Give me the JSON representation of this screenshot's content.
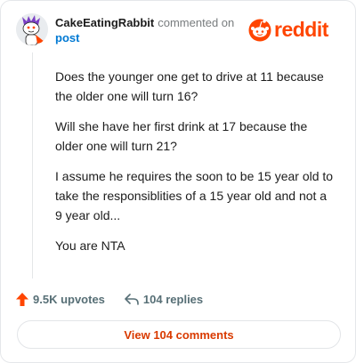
{
  "comment": {
    "author": "CakeEatingRabbit",
    "meta_text": "commented on",
    "post_link": "post",
    "paragraphs": [
      "Does the younger one get to drive at 11 because the older one will turn 16?",
      "Will she have her first drink at 17 because the older one will turn 21?",
      "I assume he requires the soon to be 15 year old to take the responsiblities of a 15 year old and not a 9 year old...",
      "You are NTA"
    ]
  },
  "brand": {
    "name": "reddit",
    "color": "#ff4500"
  },
  "actions": {
    "upvotes": "9.5K upvotes",
    "replies": "104 replies"
  },
  "view_button": {
    "label": "View 104 comments"
  },
  "icons": {
    "avatar": "snoo-avatar-icon",
    "upvote": "upvote-arrow-icon",
    "reply": "reply-arrow-icon",
    "logo": "reddit-snoo-icon"
  },
  "colors": {
    "accent": "#ff4500",
    "link": "#0079d3",
    "muted": "#576f76",
    "button_text": "#d93a00"
  }
}
